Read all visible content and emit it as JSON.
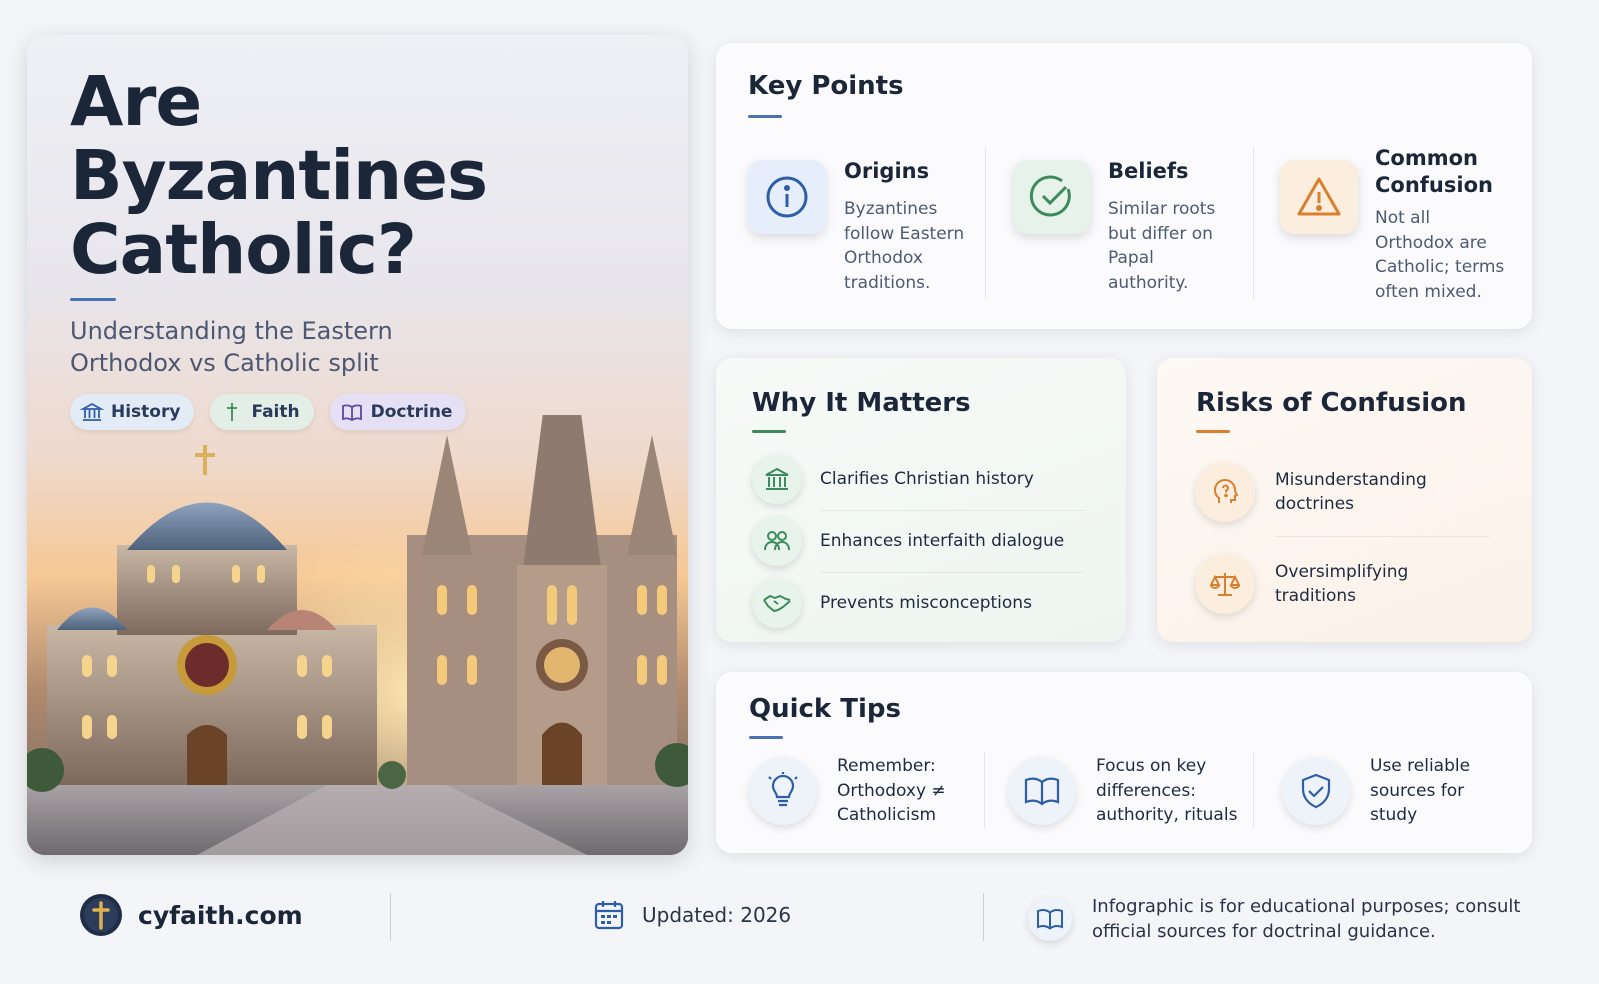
{
  "hero": {
    "title_lines": [
      "Are",
      "Byzantines",
      "Catholic?"
    ],
    "subtitle": "Understanding the Eastern Orthodox vs Catholic split",
    "tags": [
      {
        "label": "History",
        "icon": "building-columns-icon"
      },
      {
        "label": "Faith",
        "icon": "cross-icon"
      },
      {
        "label": "Doctrine",
        "icon": "open-book-icon"
      }
    ]
  },
  "key_points": {
    "title": "Key Points",
    "items": [
      {
        "name": "Origins",
        "desc": "Byzantines follow Eastern Orthodox traditions.",
        "icon": "info-icon",
        "color": "#2f5ea8"
      },
      {
        "name": "Beliefs",
        "desc": "Similar roots but differ on Papal authority.",
        "icon": "check-circle-icon",
        "color": "#3d8a5c"
      },
      {
        "name": "Common Confusion",
        "desc": "Not all Orthodox are Catholic; terms often mixed.",
        "icon": "warning-icon",
        "color": "#d9802e"
      }
    ]
  },
  "why_it_matters": {
    "title": "Why It Matters",
    "items": [
      {
        "label": "Clarifies Christian history",
        "icon": "building-columns-icon"
      },
      {
        "label": "Enhances interfaith dialogue",
        "icon": "people-icon"
      },
      {
        "label": "Prevents misconceptions",
        "icon": "handshake-icon"
      }
    ]
  },
  "risks": {
    "title": "Risks of Confusion",
    "items": [
      {
        "label": "Misunderstanding doctrines",
        "icon": "head-question-icon"
      },
      {
        "label": "Oversimplifying traditions",
        "icon": "scales-icon"
      }
    ]
  },
  "quick_tips": {
    "title": "Quick Tips",
    "items": [
      {
        "label": "Remember: Orthodoxy ≠ Catholicism",
        "icon": "lightbulb-icon"
      },
      {
        "label": "Focus on key differences: authority, rituals",
        "icon": "open-book-icon"
      },
      {
        "label": "Use reliable sources for study",
        "icon": "shield-check-icon"
      }
    ]
  },
  "footer": {
    "site": "cyfaith.com",
    "updated": "Updated: 2026",
    "disclaimer": "Infographic is for educational purposes; consult official sources for doctrinal guidance."
  },
  "colors": {
    "navy": "#1b2638",
    "blue_accent": "#4a70b6",
    "green_accent": "#3d8a5c",
    "orange_accent": "#d9802e"
  }
}
